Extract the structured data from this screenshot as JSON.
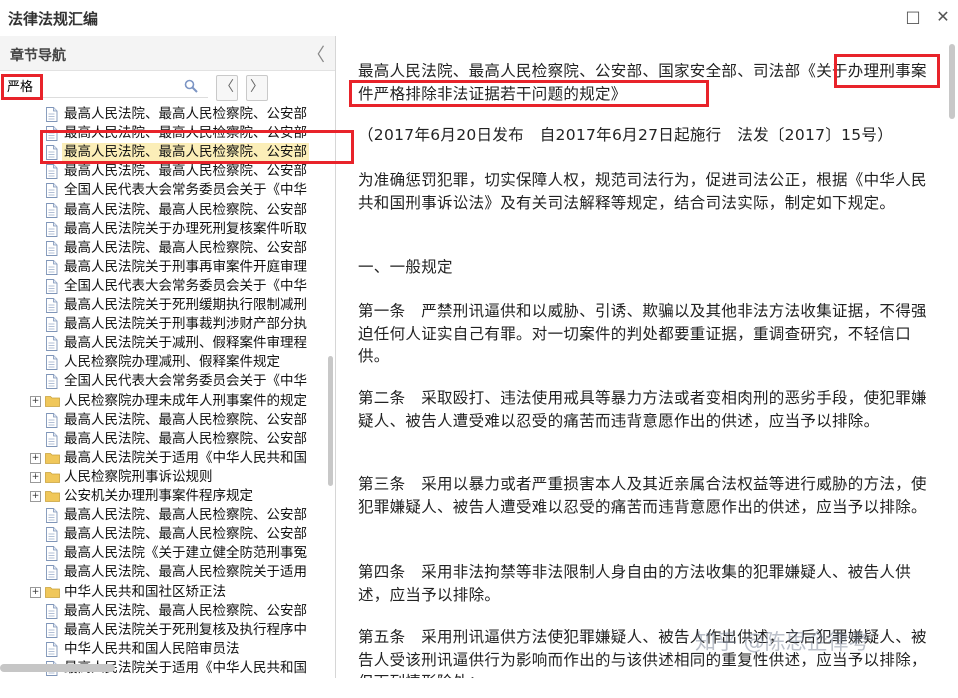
{
  "app": {
    "title": "法律法规汇编"
  },
  "window": {
    "maximize": "□",
    "close": "✕"
  },
  "sidebar": {
    "title": "章节导航",
    "collapse_glyph": "〈",
    "search": {
      "value": "严格",
      "placeholder": ""
    },
    "prev": "〈",
    "next": "〉",
    "items": [
      {
        "label": "最高人民法院、最高人民检察院、公安部",
        "folder": false
      },
      {
        "label": "最高人民法院、最高人民检察院、公安部",
        "folder": false
      },
      {
        "label": "最高人民法院、最高人民检察院、公安部",
        "folder": false,
        "selected": true
      },
      {
        "label": "最高人民法院、最高人民检察院、公安部",
        "folder": false
      },
      {
        "label": "全国人民代表大会常务委员会关于《中华",
        "folder": false
      },
      {
        "label": "最高人民法院、最高人民检察院、公安部",
        "folder": false
      },
      {
        "label": "最高人民法院关于办理死刑复核案件听取",
        "folder": false
      },
      {
        "label": "最高人民法院、最高人民检察院、公安部",
        "folder": false
      },
      {
        "label": "最高人民法院关于刑事再审案件开庭审理",
        "folder": false
      },
      {
        "label": "全国人民代表大会常务委员会关于《中华",
        "folder": false
      },
      {
        "label": "最高人民法院关于死刑缓期执行限制减刑",
        "folder": false
      },
      {
        "label": "最高人民法院关于刑事裁判涉财产部分执",
        "folder": false
      },
      {
        "label": "最高人民法院关于减刑、假释案件审理程",
        "folder": false
      },
      {
        "label": "人民检察院办理减刑、假释案件规定",
        "folder": false
      },
      {
        "label": "全国人民代表大会常务委员会关于《中华",
        "folder": false
      },
      {
        "label": "人民检察院办理未成年人刑事案件的规定",
        "folder": true
      },
      {
        "label": "最高人民法院、最高人民检察院、公安部",
        "folder": false
      },
      {
        "label": "最高人民法院、最高人民检察院、公安部",
        "folder": false
      },
      {
        "label": "最高人民法院关于适用《中华人民共和国",
        "folder": true
      },
      {
        "label": "人民检察院刑事诉讼规则",
        "folder": true
      },
      {
        "label": "公安机关办理刑事案件程序规定",
        "folder": true
      },
      {
        "label": "最高人民法院、最高人民检察院、公安部",
        "folder": false
      },
      {
        "label": "最高人民法院、最高人民检察院、公安部",
        "folder": false
      },
      {
        "label": "最高人民法院《关于建立健全防范刑事冤",
        "folder": false
      },
      {
        "label": "最高人民法院、最高人民检察院关于适用",
        "folder": false
      },
      {
        "label": "中华人民共和国社区矫正法",
        "folder": true
      },
      {
        "label": "最高人民法院、最高人民检察院、公安部",
        "folder": false
      },
      {
        "label": "最高人民法院关于死刑复核及执行程序中",
        "folder": false
      },
      {
        "label": "中华人民共和国人民陪审员法",
        "folder": false
      },
      {
        "label": "最高人民法院关于适用《中华人民共和国",
        "folder": false
      }
    ]
  },
  "doc": {
    "title": "最高人民法院、最高人民检察院、公安部、国家安全部、司法部《关于办理刑事案件严格排除非法证据若干问题的规定》",
    "meta": "（2017年6月20日发布　自2017年6月27日起施行　法发〔2017〕15号）",
    "preamble": "为准确惩罚犯罪，切实保障人权，规范司法行为，促进司法公正，根据《中华人民共和国刑事诉讼法》及有关司法解释等规定，结合司法实际，制定如下规定。",
    "section1": "一、一般规定",
    "art1": "第一条　严禁刑讯逼供和以威胁、引诱、欺骗以及其他非法方法收集证据，不得强迫任何人证实自己有罪。对一切案件的判处都要重证据，重调查研究，不轻信口供。",
    "art2": "第二条　采取殴打、违法使用戒具等暴力方法或者变相肉刑的恶劣手段，使犯罪嫌疑人、被告人遭受难以忍受的痛苦而违背意愿作出的供述，应当予以排除。",
    "art3": "第三条　采用以暴力或者严重损害本人及其近亲属合法权益等进行威胁的方法，使犯罪嫌疑人、被告人遭受难以忍受的痛苦而违背意愿作出的供述，应当予以排除。",
    "art4": "第四条　采用非法拘禁等非法限制人身自由的方法收集的犯罪嫌疑人、被告人供述，应当予以排除。",
    "art5": "第五条　采用刑讯逼供方法使犯罪嫌疑人、被告人作出供述，之后犯罪嫌疑人、被告人受该刑讯逼供行为影响而作出的与该供述相同的重复性供述，应当予以排除，但下列情形除外："
  },
  "watermark": "知乎 @陈思企律考",
  "colors": {
    "highlight": "#e8232a",
    "selected_bg": "#fbeeb8",
    "folder": "#f0c75a"
  }
}
